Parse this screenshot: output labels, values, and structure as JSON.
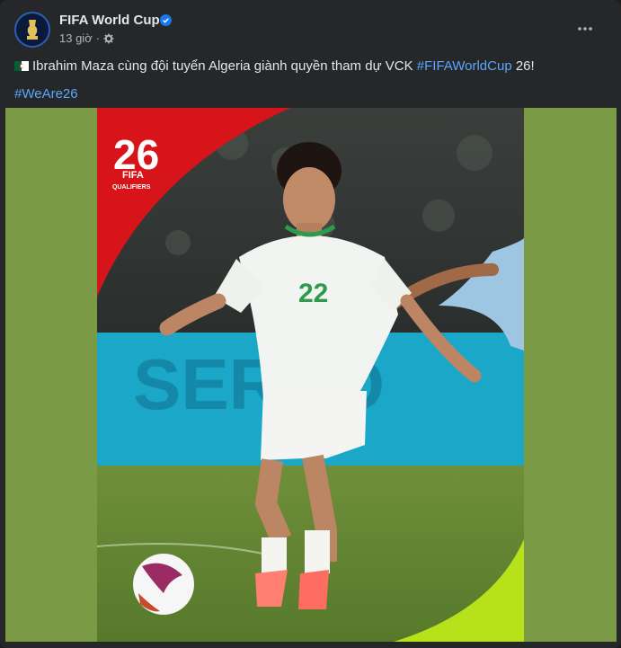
{
  "post": {
    "page_name": "FIFA World Cup",
    "timestamp": "13 giờ",
    "caption": {
      "text": "Ibrahim Maza cùng đội tuyển Algeria giành quyền tham dự VCK",
      "hashtag1": "#FIFAWorldCup",
      "suffix": "26!",
      "hashtag2": "#WeAre26"
    }
  },
  "image": {
    "badge_number": "26",
    "badge_brand": "FIFA",
    "badge_sub": "QUALIFIERS",
    "jersey_number": "22",
    "board_text": "SERPO"
  },
  "colors": {
    "card_bg": "#252728",
    "link": "#5aa7ff",
    "media_side": "#7a9a45",
    "accent_red": "#d7141a",
    "accent_lime": "#b7e21b"
  },
  "icons": [
    "fifa-avatar-icon",
    "verified-badge-icon",
    "globe-gear-icon",
    "more-options-icon",
    "algeria-flag-icon"
  ]
}
